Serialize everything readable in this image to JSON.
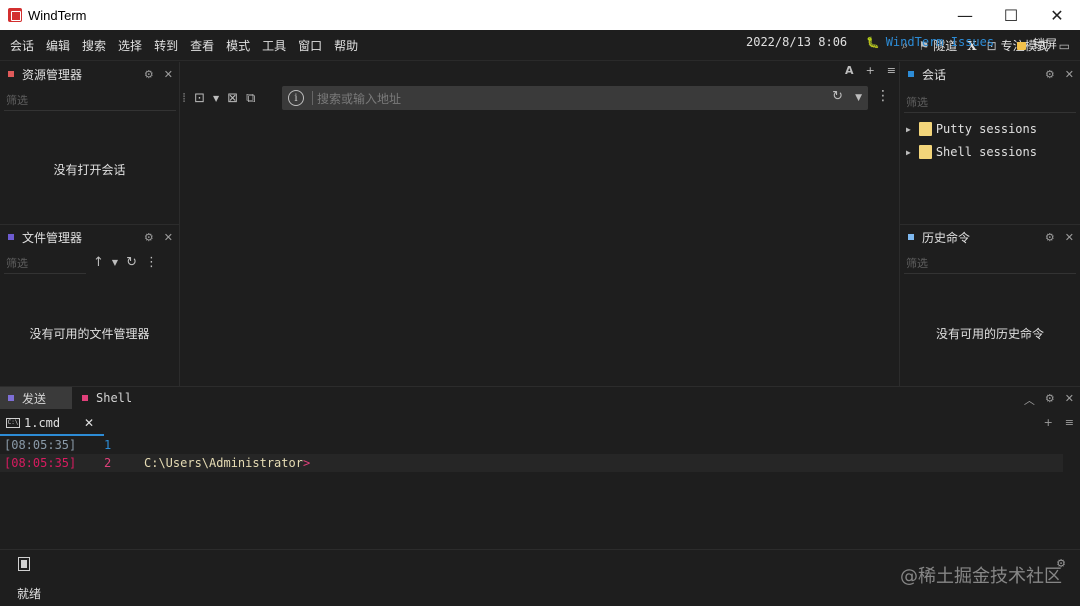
{
  "window": {
    "title": "WindTerm",
    "minimize": "—",
    "maximize": "☐",
    "close": "✕"
  },
  "menu": {
    "items": [
      "会话",
      "编辑",
      "搜索",
      "选择",
      "转到",
      "查看",
      "模式",
      "工具",
      "窗口",
      "帮助"
    ],
    "tunnel": "隧道",
    "x": "X",
    "focus": "专注模式"
  },
  "resource_manager": {
    "title": "资源管理器",
    "filter_placeholder": "筛选",
    "empty": "没有打开会话",
    "dot_color": "#e05a5a"
  },
  "file_manager": {
    "title": "文件管理器",
    "filter_placeholder": "筛选",
    "empty": "没有可用的文件管理器",
    "dot_color": "#6d5bd0"
  },
  "address_bar": {
    "placeholder": "搜索或输入地址",
    "font_button": "A"
  },
  "sessions": {
    "title": "会话",
    "filter_placeholder": "筛选",
    "dot_color": "#2d8cd6",
    "items": [
      "Putty sessions",
      "Shell sessions"
    ]
  },
  "history": {
    "title": "历史命令",
    "filter_placeholder": "筛选",
    "empty": "没有可用的历史命令",
    "dot_color": "#7fb9f0"
  },
  "bottom_tabs": {
    "send": "发送",
    "shell": "Shell",
    "send_dot": "#7e6fd6",
    "shell_dot": "#e0407a"
  },
  "terminal": {
    "tab": "1.cmd",
    "tab_close": "✕",
    "lines": [
      {
        "ts": "[08:05:35]",
        "num": "1",
        "text": ""
      },
      {
        "ts": "[08:05:35]",
        "num": "2",
        "text": "C:\\Users\\Administrator",
        "prompt": ">"
      }
    ]
  },
  "status": {
    "ready": "就绪",
    "datetime": "2022/8/13 8:06",
    "issues": "WindTerm Issues",
    "lock": "锁屏"
  },
  "watermark": "@稀土掘金技术社区"
}
